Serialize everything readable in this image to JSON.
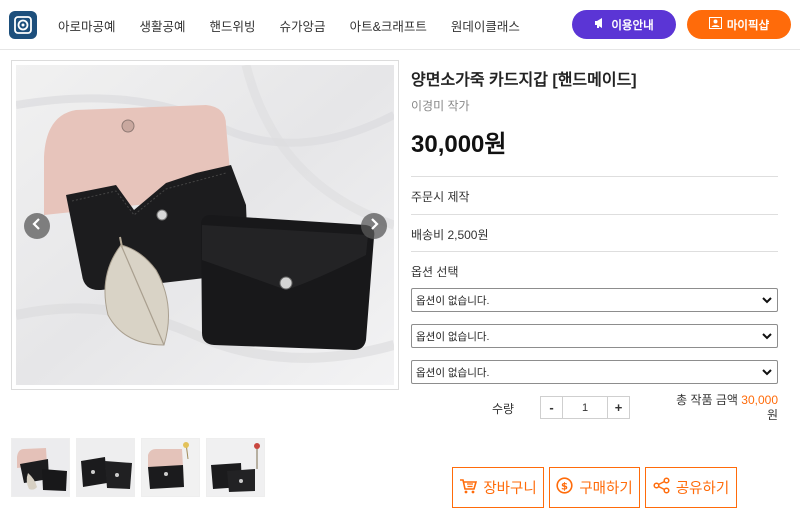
{
  "nav": {
    "items": [
      "아로마공예",
      "생활공예",
      "핸드위빙",
      "슈가앙금",
      "아트&크래프트",
      "원데이클래스"
    ],
    "guide_label": "이용안내",
    "myshop_label": "마이픽샵"
  },
  "product": {
    "title": "양면소가죽 카드지갑 [핸드메이드]",
    "author": "이경미 작가",
    "price": "30,000원",
    "production": "주문시 제작",
    "shipping": "배송비 2,500원",
    "option_heading": "옵션 선택",
    "options": [
      "옵션이 없습니다.",
      "옵션이 없습니다.",
      "옵션이 없습니다."
    ],
    "quantity_label": "수량",
    "quantity_value": "1",
    "qty_minus": "-",
    "qty_plus": "+",
    "total_label": "총 작품 금액",
    "total_amount": "30,000",
    "total_unit": "원"
  },
  "actions": {
    "cart_label": "장바구니",
    "buy_label": "구매하기",
    "share_label": "공유하기"
  },
  "icons": {
    "logo": "logo-icon",
    "guide": "megaphone-icon",
    "myshop": "shop-icon",
    "prev": "chevron-left-icon",
    "next": "chevron-right-icon",
    "cart": "cart-icon",
    "buy": "dollar-icon",
    "share": "share-icon"
  },
  "colors": {
    "brand_purple": "#5b35d5",
    "brand_orange": "#ff6b0a",
    "logo_blue": "#1d4f7c"
  }
}
